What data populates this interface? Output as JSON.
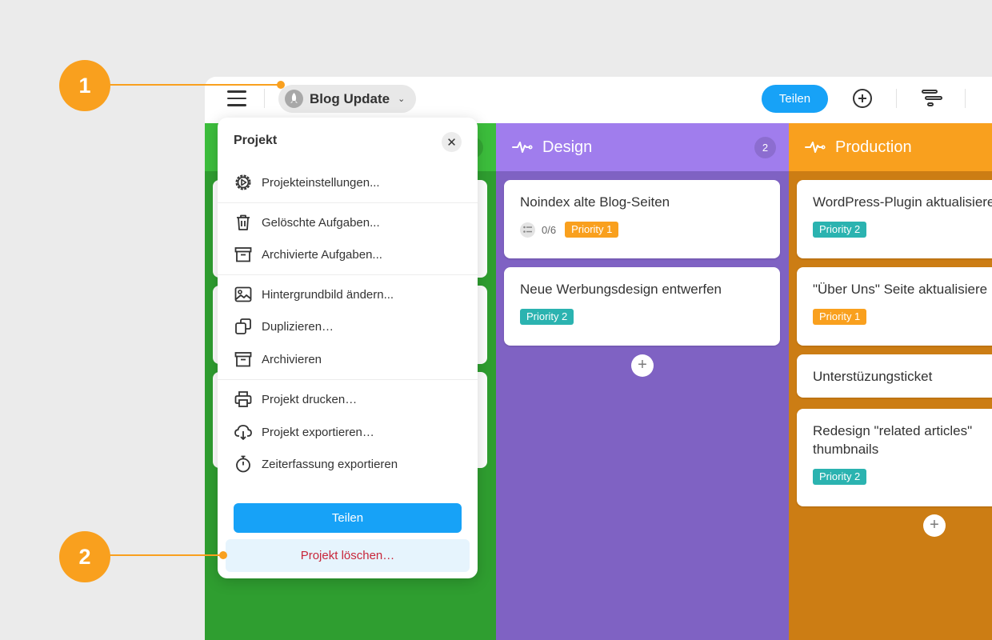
{
  "topbar": {
    "project_name": "Blog Update",
    "share_label": "Teilen"
  },
  "columns": [
    {
      "name": "Design",
      "count": "2"
    },
    {
      "name": "Production"
    }
  ],
  "design_cards": [
    {
      "title": "Noindex alte Blog-Seiten",
      "checklist": "0/6",
      "priority": "Priority 1"
    },
    {
      "title": "Neue Werbungsdesign entwerfen",
      "priority": "Priority 2"
    }
  ],
  "production_cards": [
    {
      "title": "WordPress-Plugin aktualisiere",
      "priority": "Priority 2"
    },
    {
      "title": "\"Über Uns\" Seite aktualisiere",
      "priority": "Priority 1"
    },
    {
      "title": "Unterstüzungsticket"
    },
    {
      "title": "Redesign \"related articles\" thumbnails",
      "priority": "Priority 2"
    }
  ],
  "menu": {
    "title": "Projekt",
    "items": [
      {
        "label": "Projekteinstellungen...",
        "icon": "gear-icon"
      },
      {
        "label": "Gelöschte Aufgaben...",
        "icon": "trash-icon"
      },
      {
        "label": "Archivierte Aufgaben...",
        "icon": "archive-icon"
      },
      {
        "label": "Hintergrundbild ändern...",
        "icon": "image-icon"
      },
      {
        "label": "Duplizieren…",
        "icon": "duplicate-icon"
      },
      {
        "label": "Archivieren",
        "icon": "archive-icon"
      },
      {
        "label": "Projekt drucken…",
        "icon": "printer-icon"
      },
      {
        "label": "Projekt exportieren…",
        "icon": "cloud-download-icon"
      },
      {
        "label": "Zeiterfassung exportieren",
        "icon": "stopwatch-icon"
      }
    ],
    "share_label": "Teilen",
    "delete_label": "Projekt löschen…"
  },
  "callouts": [
    "1",
    "2"
  ],
  "colors": {
    "accent_blue": "#17a2f7",
    "green_column": "#2f9e30",
    "purple_column": "#7f62c3",
    "orange_column": "#cc7d14",
    "priority_1": "#f9a01e",
    "priority_2": "#2bb3b0",
    "callout": "#f9a01e",
    "delete_text": "#c8263a"
  }
}
